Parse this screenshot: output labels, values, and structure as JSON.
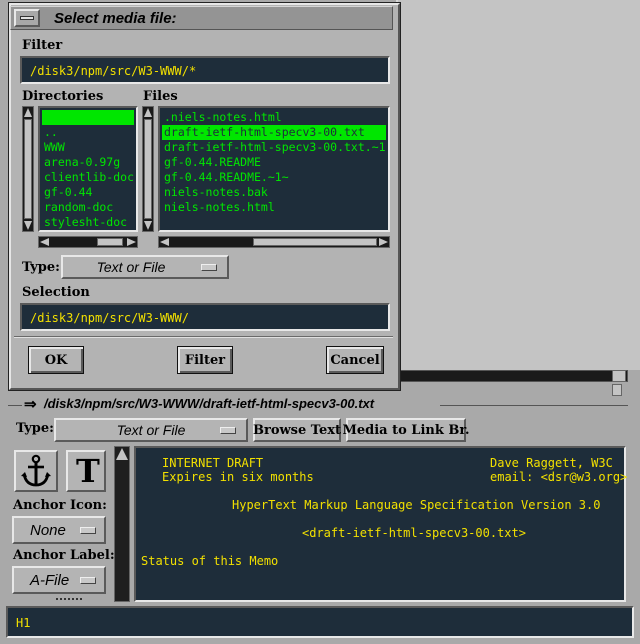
{
  "editor": {
    "path": "/disk3/npm/src/W3-WWW/draft-ietf-html-specv3-00.txt",
    "type_label": "Type:",
    "type_value": "Text or File",
    "browse_text_label": "Browse Text",
    "media_link_label": "Media to Link Br.",
    "tool_text_glyph": "T",
    "anchor_icon_label": "Anchor Icon:",
    "anchor_icon_value": "None",
    "anchor_label_label": "Anchor Label:",
    "anchor_label_value": "A-File",
    "content": {
      "line1_left": "INTERNET DRAFT",
      "line1_right": "Dave Raggett, W3C",
      "line2_left": "Expires in six months",
      "line2_right": "email: <dsr@w3.org>",
      "title": "HyperText Markup Language Specification Version 3.0",
      "filename": "<draft-ietf-html-specv3-00.txt>",
      "section": "Status of this Memo"
    },
    "status": "H1"
  },
  "dialog": {
    "title": "Select media file:",
    "filter_label": "Filter",
    "filter_value": "/disk3/npm/src/W3-WWW/*",
    "directories_label": "Directories",
    "directories": [
      "",
      "..",
      "WWW",
      "arena-0.97g",
      "clientlib-doc",
      "gf-0.44",
      "random-doc",
      "stylesht-doc"
    ],
    "files_label": "Files",
    "files": [
      ".niels-notes.html",
      "draft-ietf-html-specv3-00.txt",
      "draft-ietf-html-specv3-00.txt.~1",
      "gf-0.44.README",
      "gf-0.44.README.~1~",
      "niels-notes.bak",
      "niels-notes.html"
    ],
    "type_label": "Type:",
    "type_value": "Text or File",
    "selection_label": "Selection",
    "selection_value": "/disk3/npm/src/W3-WWW/",
    "ok_label": "OK",
    "filter_button_label": "Filter",
    "cancel_label": "Cancel"
  },
  "colors": {
    "text_bg": "#1e2d3a",
    "text_fg": "#f2e000",
    "list_fg": "#00e600",
    "chrome": "#b3b3b3"
  }
}
